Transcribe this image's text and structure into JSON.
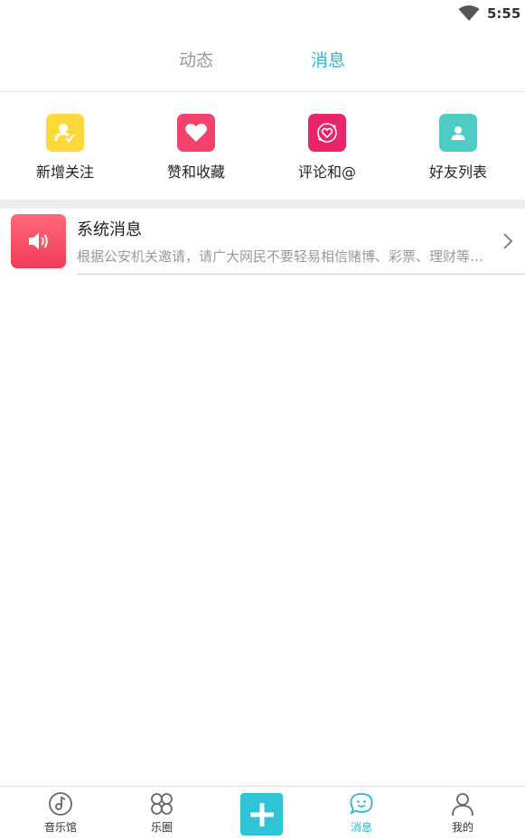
{
  "status_bar": {
    "time": "5:55",
    "wifi_icon": "wifi-icon"
  },
  "top_tabs": [
    {
      "label": "动态",
      "active": false
    },
    {
      "label": "消息",
      "active": true
    }
  ],
  "quick_actions": [
    {
      "label": "新增关注",
      "icon": "new-follower-icon",
      "color": "#ffd93b"
    },
    {
      "label": "赞和收藏",
      "icon": "heart-icon",
      "color": "#f5426c"
    },
    {
      "label": "评论和@",
      "icon": "comment-heart-icon",
      "color": "#e8256b"
    },
    {
      "label": "好友列表",
      "icon": "friends-icon",
      "color": "#4ecdc4"
    }
  ],
  "system_message": {
    "title": "系统消息",
    "preview": "根据公安机关邀请，请广大网民不要轻易相信赌博、彩票、理财等诈骗信息",
    "icon": "speaker-icon"
  },
  "bottom_nav": [
    {
      "label": "音乐馆",
      "icon": "music-disc-icon",
      "active": false
    },
    {
      "label": "乐圈",
      "icon": "clover-icon",
      "active": false
    },
    {
      "label": "",
      "icon": "plus-icon",
      "active": false
    },
    {
      "label": "消息",
      "icon": "chat-bubble-icon",
      "active": true
    },
    {
      "label": "我的",
      "icon": "person-icon",
      "active": false
    }
  ],
  "colors": {
    "accent": "#29b6d1",
    "plus_button": "#2ec4d6"
  }
}
